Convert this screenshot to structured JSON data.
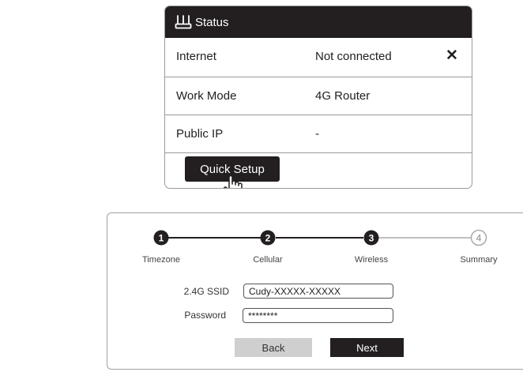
{
  "status_panel": {
    "title": "Status",
    "icon": "router-icon",
    "rows": [
      {
        "label": "Internet",
        "value": "Not connected",
        "status_icon": "close-icon",
        "status_glyph": "✕"
      },
      {
        "label": "Work Mode",
        "value": "4G Router"
      },
      {
        "label": "Public IP",
        "value": "-"
      }
    ],
    "quick_setup_label": "Quick Setup",
    "cursor_icon": "hand-pointer-icon"
  },
  "wizard": {
    "steps": [
      {
        "number": "1",
        "label": "Timezone",
        "state": "done"
      },
      {
        "number": "2",
        "label": "Cellular",
        "state": "done"
      },
      {
        "number": "3",
        "label": "Wireless",
        "state": "current"
      },
      {
        "number": "4",
        "label": "Summary",
        "state": "pending"
      }
    ],
    "ssid_label": "2.4G SSID",
    "ssid_value": "Cudy-XXXXX-XXXXX",
    "password_label": "Password",
    "password_value": "********",
    "back_label": "Back",
    "next_label": "Next"
  },
  "colors": {
    "dark": "#231f20",
    "border": "#9a9a9a",
    "pending": "#aaaaaa",
    "back_button": "#cfcfcf"
  }
}
